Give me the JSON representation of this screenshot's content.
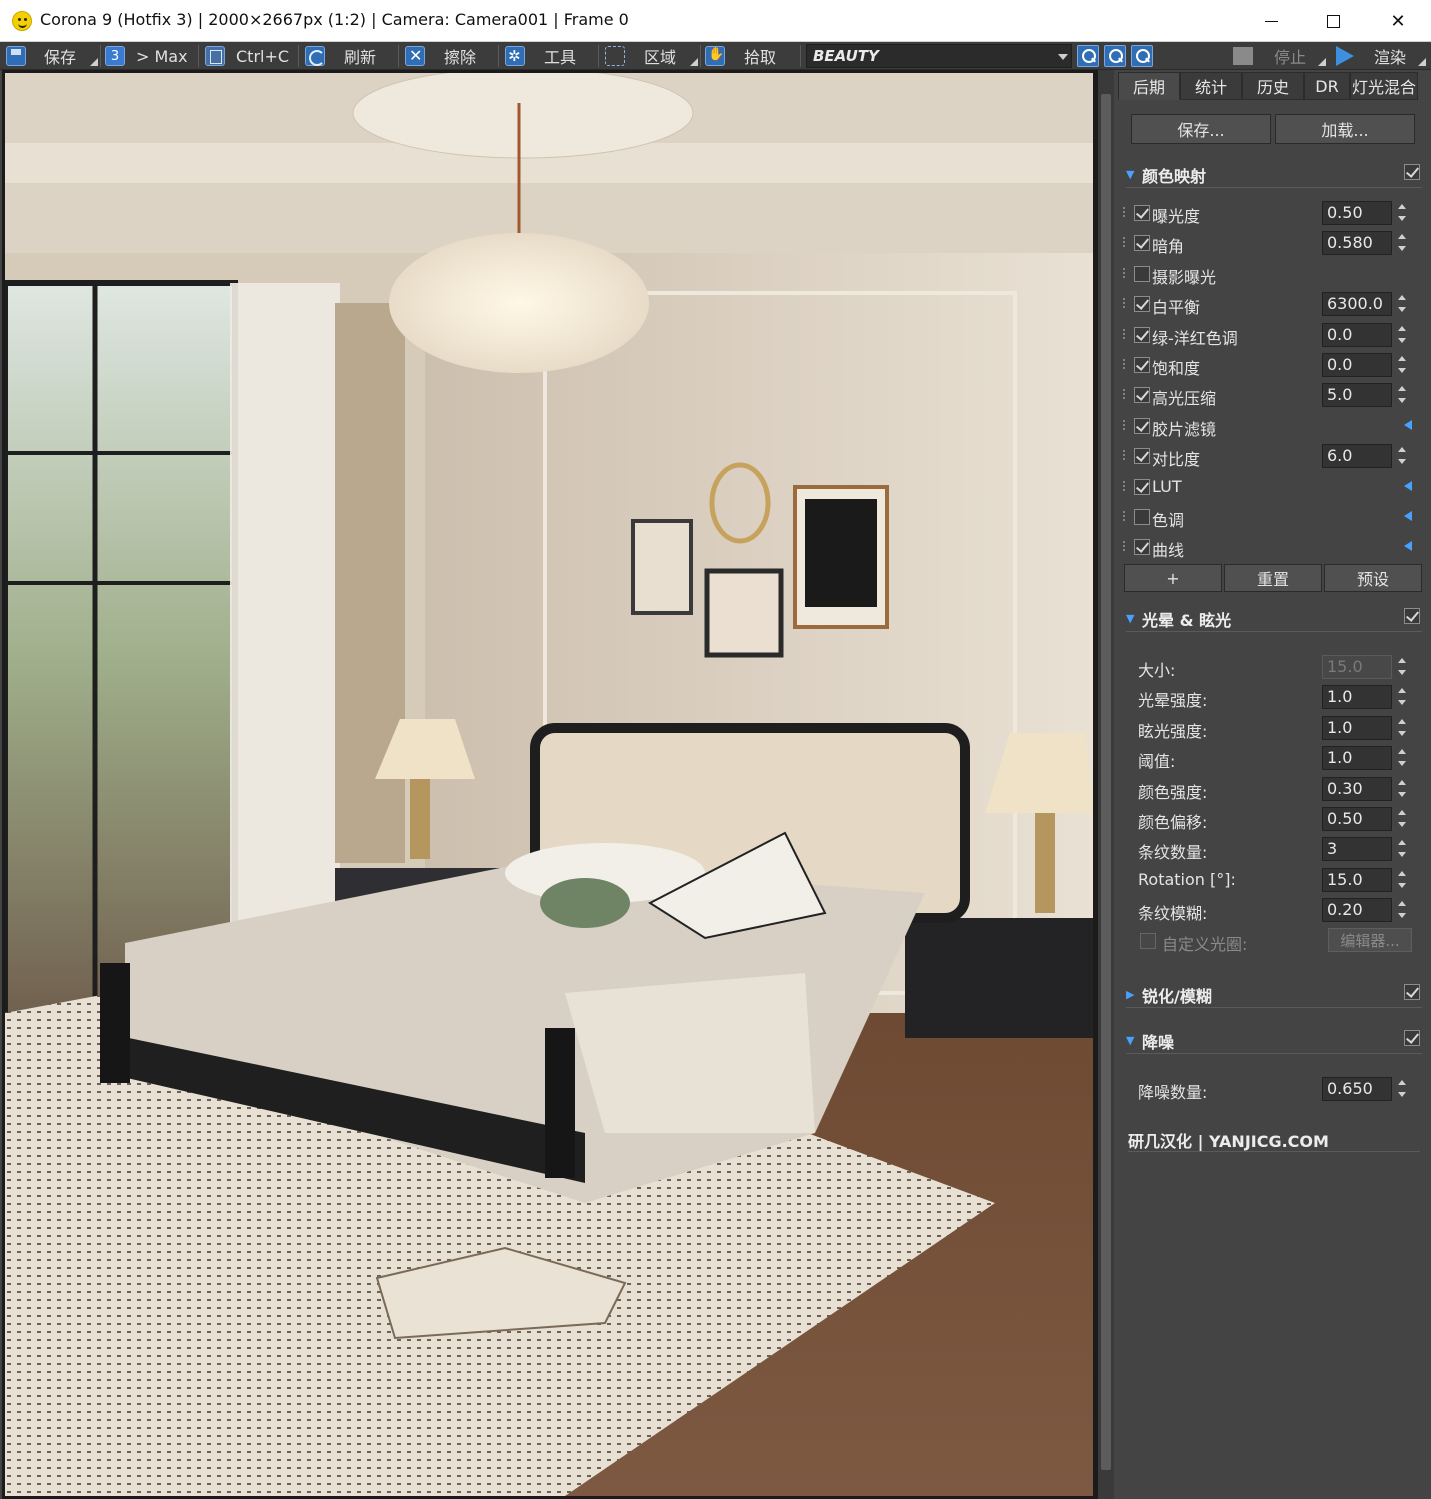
{
  "window": {
    "title": "Corona 9 (Hotfix 3) | 2000×2667px (1:2) | Camera: Camera001 | Frame 0",
    "minimize": "",
    "maximize": "",
    "close": "✕"
  },
  "toolbar": {
    "save": "保存",
    "to_max": "> Max",
    "copy": "Ctrl+C",
    "refresh": "刷新",
    "clear": "擦除",
    "tools": "工具",
    "region": "区域",
    "pick": "拾取",
    "render_pass": "BEAUTY",
    "stop": "停止",
    "render": "渲染"
  },
  "panel": {
    "tabs": [
      "后期",
      "统计",
      "历史",
      "DR",
      "灯光混合"
    ],
    "save_button": "保存...",
    "load_button": "加载...",
    "tone_mapping": {
      "title": "颜色映射",
      "enabled": true,
      "rows": [
        {
          "label": "曝光度",
          "checked": true,
          "value": "0.50"
        },
        {
          "label": "暗角",
          "checked": true,
          "value": "0.580"
        },
        {
          "label": "摄影曝光",
          "checked": false
        },
        {
          "label": "白平衡",
          "checked": true,
          "value": "6300.0"
        },
        {
          "label": "绿-洋红色调",
          "checked": true,
          "value": "0.0"
        },
        {
          "label": "饱和度",
          "checked": true,
          "value": "0.0"
        },
        {
          "label": "高光压缩",
          "checked": true,
          "value": "5.0"
        },
        {
          "label": "胶片滤镜",
          "checked": true
        },
        {
          "label": "对比度",
          "checked": true,
          "value": "6.0"
        },
        {
          "label": "LUT",
          "checked": true
        },
        {
          "label": "色调",
          "checked": false
        },
        {
          "label": "曲线",
          "checked": true
        }
      ],
      "add_button": "+",
      "reset_button": "重置",
      "preset_button": "预设"
    },
    "bloom_glare": {
      "title": "光晕 & 眩光",
      "enabled": true,
      "rows": [
        {
          "label": "大小:",
          "value": "15.0",
          "disabled": true
        },
        {
          "label": "光晕强度:",
          "value": "1.0"
        },
        {
          "label": "眩光强度:",
          "value": "1.0"
        },
        {
          "label": "阈值:",
          "value": "1.0"
        },
        {
          "label": "颜色强度:",
          "value": "0.30"
        },
        {
          "label": "颜色偏移:",
          "value": "0.50"
        },
        {
          "label": "条纹数量:",
          "value": "3"
        },
        {
          "label": "Rotation [°]:",
          "value": "15.0"
        },
        {
          "label": "条纹模糊:",
          "value": "0.20"
        }
      ],
      "custom_aperture": "自定义光圈:",
      "editor_button": "编辑器..."
    },
    "sharpen_blur": {
      "title": "锐化/模糊",
      "enabled": true
    },
    "denoise": {
      "title": "降噪",
      "enabled": true,
      "amount_label": "降噪数量:",
      "amount_value": "0.650"
    },
    "footer": "研几汉化 | YANJICG.COM"
  },
  "colors": {
    "accent": "#4aa0ff",
    "panel_bg": "#444444",
    "toolbar_bg": "#3c3c3c"
  }
}
